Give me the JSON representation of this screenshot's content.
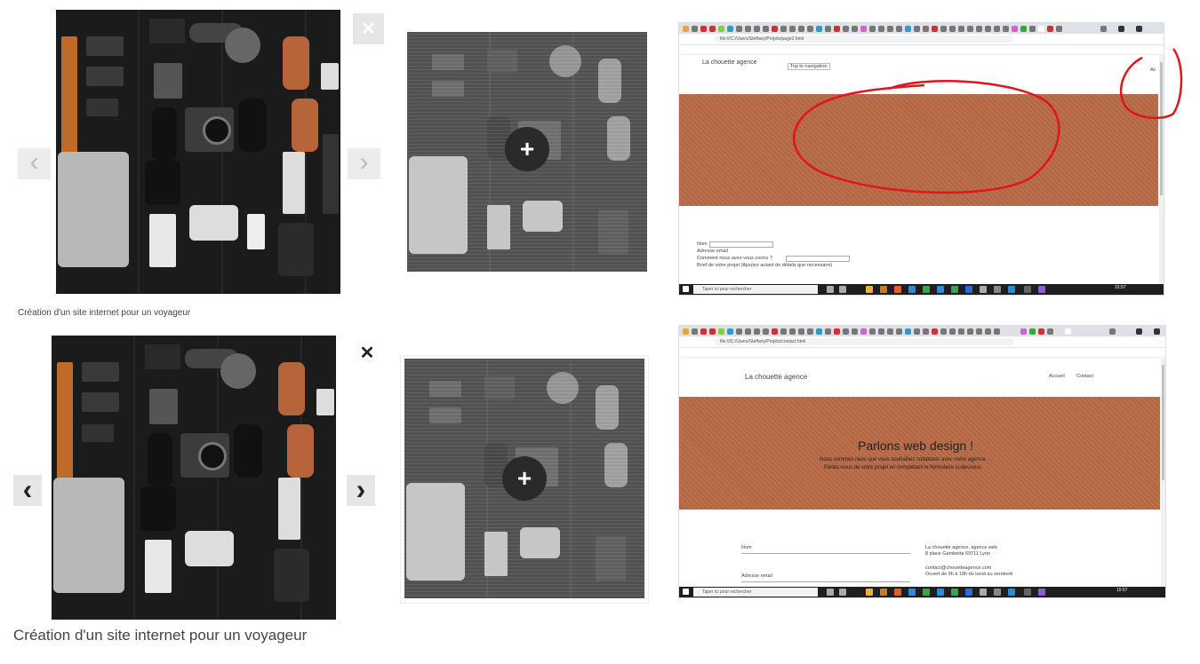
{
  "lightbox": {
    "caption": "Création d'un site internet pour un voyageur",
    "close_glyph": "✕",
    "prev_glyph": "‹",
    "next_glyph": "›",
    "plus_glyph": "+"
  },
  "screenshot_top": {
    "url": "file:///C:/Users/Steffany/Projets/page2.html",
    "brand": "La chouette agence",
    "skip_link": "Top to navigation",
    "corner_link": "Ac",
    "form_labels": [
      "Nom",
      "Adresse email",
      "Comment nous avez-vous connu ?",
      "Brief de votre projet (Ajoutez autant de détails que nécessaire)"
    ],
    "taskbar_search": "Taper ici pour rechercher",
    "clock": "15:57"
  },
  "screenshot_bottom": {
    "url": "file:///C:/Users/Steffany/Projets/contact.html",
    "brand": "La chouette agence",
    "nav": [
      "Accueil",
      "Contact"
    ],
    "hero_title": "Parlons web design !",
    "hero_text_1": "Nous sommes ravis que vous souhaitiez collaborer avec notre agence.",
    "hero_text_2": "Parlez-nous de votre projet en complétant le formulaire ci-dessous.",
    "form_labels": [
      "Nom",
      "Adresse email"
    ],
    "contact_lines": [
      "La chouette agence, agence web",
      "8 place Gambetta 69711 Lyon",
      "contact@chouetteagence.com",
      "Ouvert de 9h à 18h du lundi au vendredi"
    ],
    "taskbar_search": "Taper ici pour rechercher",
    "clock": "15:57"
  },
  "colors": {
    "banner": "#b86a47",
    "annotation": "#e0151d",
    "button_bg": "#e6e6e6"
  }
}
